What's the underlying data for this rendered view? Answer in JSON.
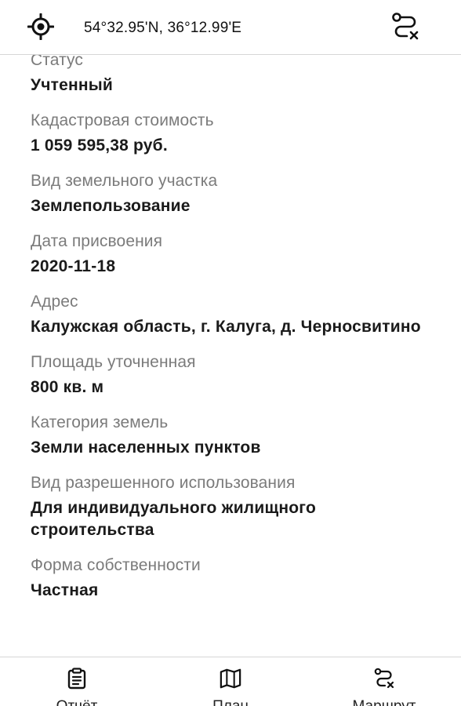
{
  "header": {
    "coordinates": "54°32.95'N, 36°12.99'E",
    "locate_icon": "crosshair-locate-icon",
    "route_clear_icon": "route-clear-icon"
  },
  "fields": [
    {
      "label": "Статус",
      "value": "Учтенный"
    },
    {
      "label": "Кадастровая стоимость",
      "value": "1 059 595,38 руб."
    },
    {
      "label": "Вид земельного участка",
      "value": "Землепользование"
    },
    {
      "label": "Дата присвоения",
      "value": "2020-11-18"
    },
    {
      "label": "Адрес",
      "value": "Калужская область, г. Калуга, д. Черносвитино"
    },
    {
      "label": "Площадь уточненная",
      "value": "800 кв. м"
    },
    {
      "label": "Категория земель",
      "value": "Земли населенных пунктов"
    },
    {
      "label": "Вид разрешенного использования",
      "value": "Для индивидуального жилищного строительства"
    },
    {
      "label": "Форма собственности",
      "value": "Частная"
    }
  ],
  "bottom_nav": {
    "items": [
      {
        "label": "Отчёт",
        "icon": "clipboard-report-icon"
      },
      {
        "label": "План",
        "icon": "map-plan-icon"
      },
      {
        "label": "Маршрут",
        "icon": "route-icon"
      }
    ]
  }
}
